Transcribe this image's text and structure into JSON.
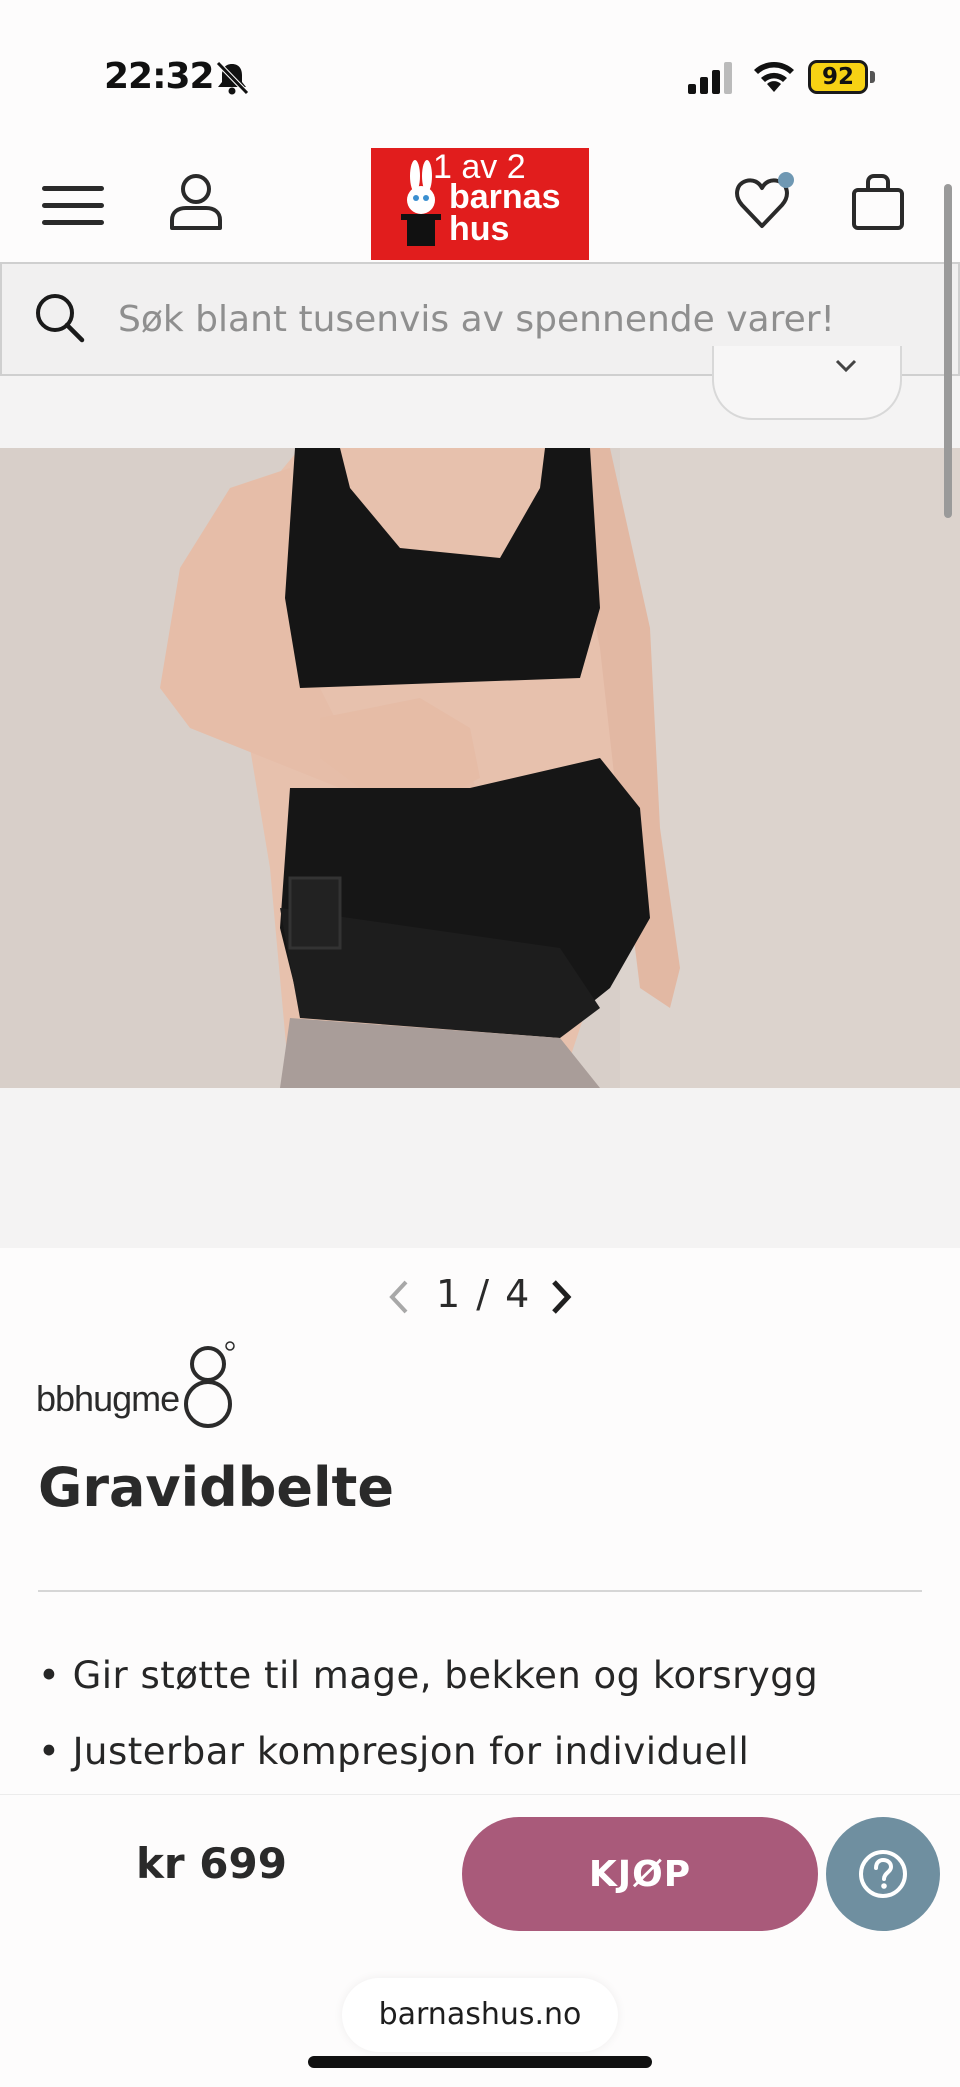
{
  "status_bar": {
    "time": "22:32",
    "battery": "92"
  },
  "header": {
    "logo": {
      "line1": "1 av 2",
      "line2": "barnas",
      "line3": "hus"
    },
    "colors": {
      "logo_bg": "#e11d1d",
      "wishlist_dot": "#6f98b3"
    }
  },
  "search": {
    "placeholder": "Søk blant tusenvis av spennende varer!",
    "value": ""
  },
  "gallery": {
    "current": "1",
    "total": "4",
    "pager_text": "1 / 4"
  },
  "product": {
    "brand": "bbhugme",
    "title": "Gravidbelte",
    "bullets": [
      "• Gir støtte til mage, bekken og korsrygg",
      "• Justerbar kompresjon for individuell"
    ]
  },
  "buy_bar": {
    "price": "kr 699",
    "buy_label": "KJØP",
    "colors": {
      "buy": "#a95a7a",
      "help": "#6f8fa0"
    }
  },
  "browser": {
    "domain": "barnashus.no"
  }
}
